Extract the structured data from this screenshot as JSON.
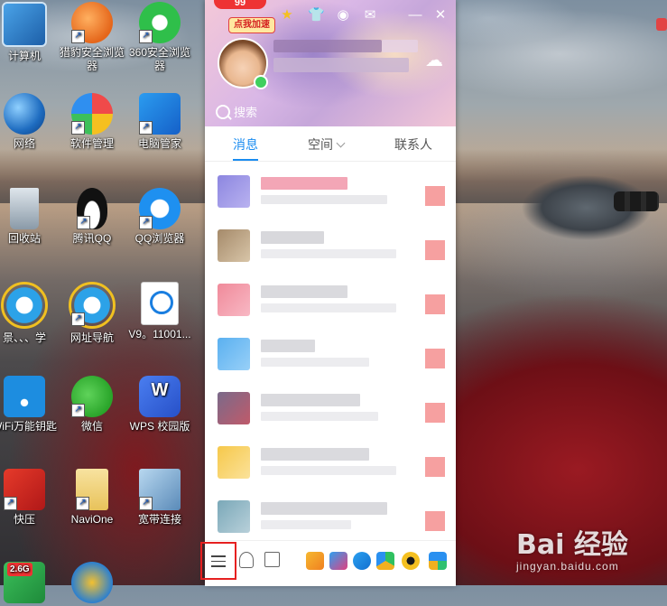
{
  "desktop": {
    "icons": [
      {
        "label": "计算机"
      },
      {
        "label": "猎豹安全浏览器"
      },
      {
        "label": "360安全浏览器"
      },
      {
        "label": "网络"
      },
      {
        "label": "软件管理"
      },
      {
        "label": "电脑管家"
      },
      {
        "label": "回收站"
      },
      {
        "label": "腾讯QQ"
      },
      {
        "label": "QQ浏览器"
      },
      {
        "label": "景、、、学"
      },
      {
        "label": "网址导航"
      },
      {
        "label": "V9。11001..."
      },
      {
        "label": "WiFi万能钥匙"
      },
      {
        "label": "微信"
      },
      {
        "label": "WPS 校园版"
      },
      {
        "label": "快压"
      },
      {
        "label": "NaviOne"
      },
      {
        "label": "宽带连接"
      },
      {
        "label": "2.6G"
      }
    ]
  },
  "qq": {
    "speed_badge": "点我加速",
    "level_bubble": "99",
    "search_placeholder": "搜索",
    "tabs": [
      {
        "label": "消息"
      },
      {
        "label": "空间"
      },
      {
        "label": "联系人"
      }
    ],
    "active_tab": "消息",
    "accent_color": "#1a8cf0"
  },
  "watermark": {
    "logo": "Bai 经验",
    "url": "jingyan.baidu.com"
  }
}
